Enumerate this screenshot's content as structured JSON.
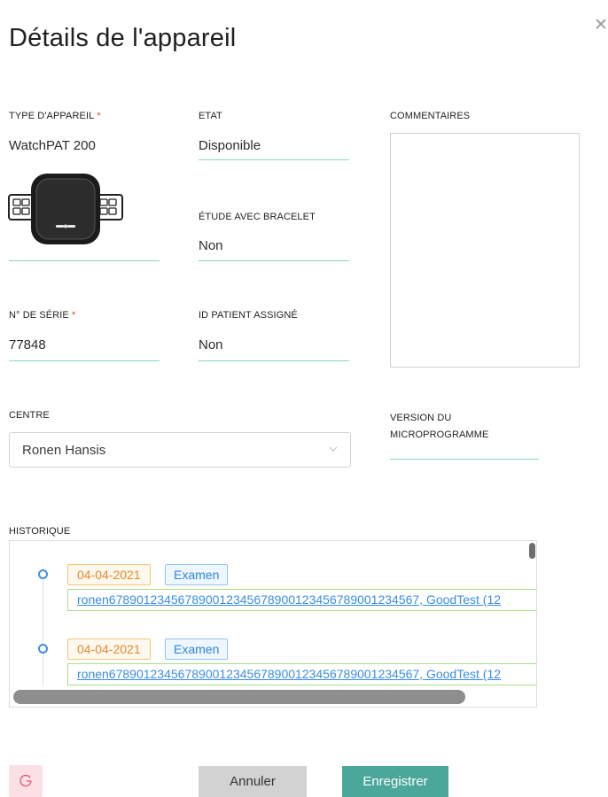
{
  "dialog": {
    "title": "Détails de l'appareil",
    "close_symbol": "✕"
  },
  "fields": {
    "device_type": {
      "label": "TYPE D'APPAREIL",
      "required_mark": "*",
      "value": "WatchPAT 200"
    },
    "state": {
      "label": "ETAT",
      "value": "Disponible"
    },
    "comments": {
      "label": "COMMENTAIRES",
      "value": ""
    },
    "bracelet_study": {
      "label": "ÉTUDE AVEC BRACELET",
      "value": "Non"
    },
    "serial": {
      "label": "N° DE SÉRIE",
      "required_mark": "*",
      "value": "77848"
    },
    "assigned_patient": {
      "label": "ID PATIENT ASSIGNÉ",
      "value": "Non"
    },
    "center": {
      "label": "CENTRE",
      "value": "Ronen Hansis"
    },
    "firmware": {
      "label_line1": "VERSION DU",
      "label_line2": "MICROPROGRAMME",
      "value": ""
    }
  },
  "history": {
    "label": "HISTORIQUE",
    "entries": [
      {
        "date": "04-04-2021",
        "type": "Examen",
        "link": "ronen678901234567890012345678900123456789001234567, GoodTest (12"
      },
      {
        "date": "04-04-2021",
        "type": "Examen",
        "link": "ronen678901234567890012345678900123456789001234567, GoodTest (12"
      }
    ]
  },
  "footer": {
    "cancel_label": "Annuler",
    "save_label": "Enregistrer"
  },
  "icons": {
    "close": "close-icon",
    "device": "watchpat-device-icon",
    "dropdown": "chevron-down-icon",
    "refresh": "refresh-icon",
    "timeline_dot": "timeline-dot-icon"
  },
  "colors": {
    "accent_underline": "#88d4c6",
    "save_button": "#4aa79a",
    "cancel_button": "#d2d2d2",
    "required": "#e5413b",
    "date_tag": "#e5892e",
    "type_tag": "#2f86d6",
    "link": "#3b8ee0",
    "link_border": "#a9df86",
    "refresh_button_bg": "#fbe0e6"
  }
}
